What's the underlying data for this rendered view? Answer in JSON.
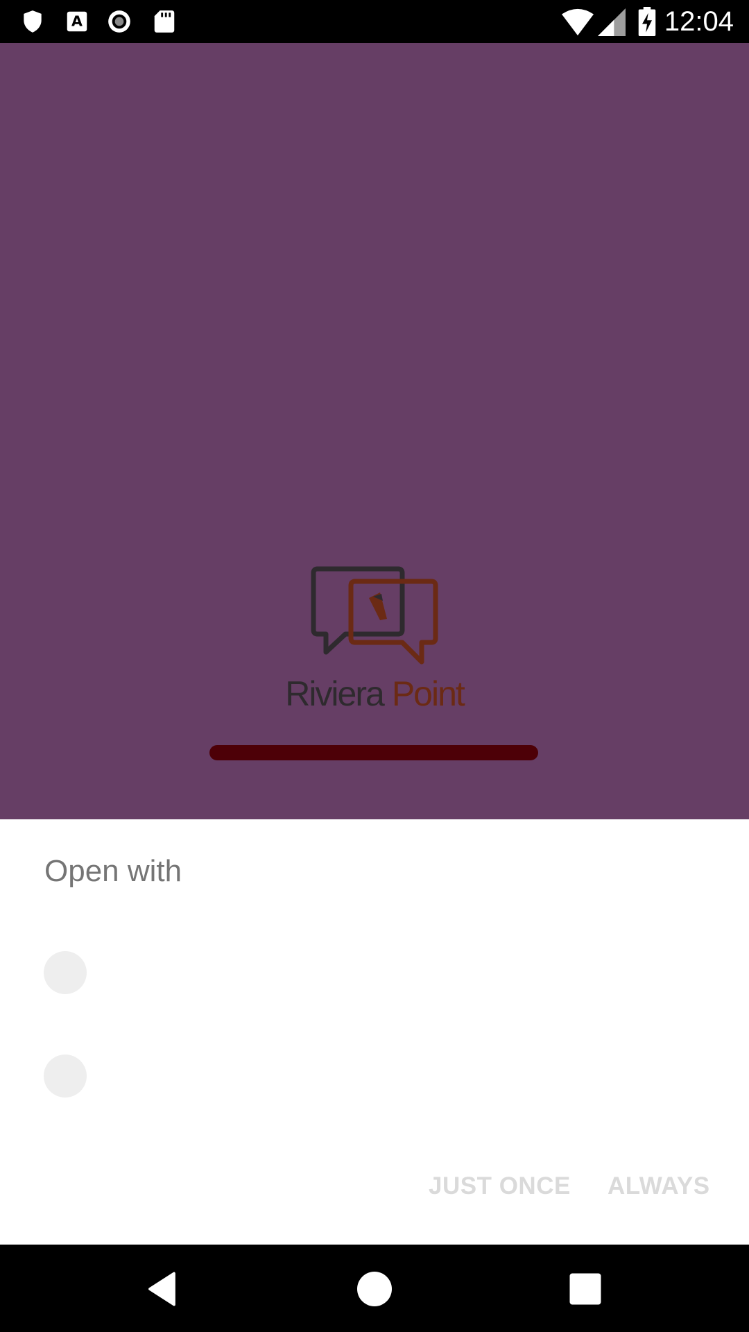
{
  "status_bar": {
    "time": "12:04",
    "icons_left": [
      "shield-icon",
      "font-icon",
      "record-icon",
      "sd-card-icon"
    ],
    "icons_right": [
      "wifi-icon",
      "signal-icon",
      "battery-charging-icon"
    ]
  },
  "app": {
    "background": "#663e65",
    "brand_word1": "Riviera",
    "brand_word2": "Point",
    "progress_color": "#4d0007"
  },
  "chooser": {
    "title": "Open with",
    "app_options": [
      {
        "icon": "app-placeholder-icon"
      },
      {
        "icon": "app-placeholder-icon"
      }
    ],
    "just_once_label": "JUST ONCE",
    "always_label": "ALWAYS"
  },
  "nav_bar": {
    "buttons": [
      "back-icon",
      "home-icon",
      "recents-icon"
    ]
  }
}
